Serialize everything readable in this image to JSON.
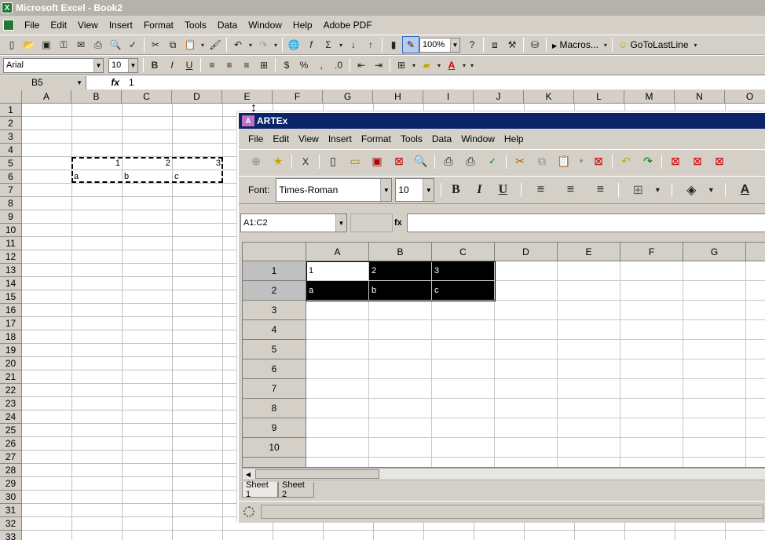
{
  "excel": {
    "title": "Microsoft Excel - Book2",
    "menu": [
      "File",
      "Edit",
      "View",
      "Insert",
      "Format",
      "Tools",
      "Data",
      "Window",
      "Help",
      "Adobe PDF"
    ],
    "toolbar": {
      "zoom": "100%",
      "macros_label": "Macros...",
      "gotolastline_label": "GoToLastLine",
      "font": "Arial",
      "font_size": "10"
    },
    "formula_bar": {
      "name_box": "B5",
      "fx": "fx",
      "value": "1"
    },
    "columns": [
      "A",
      "B",
      "C",
      "D",
      "E",
      "F",
      "G",
      "H",
      "I",
      "J",
      "K",
      "L",
      "M",
      "N",
      "O"
    ],
    "rows": [
      "1",
      "2",
      "3",
      "4",
      "5",
      "6",
      "7",
      "8",
      "9",
      "10",
      "11",
      "12",
      "13",
      "14",
      "15",
      "16",
      "17",
      "18",
      "19",
      "20",
      "21",
      "22",
      "23",
      "24",
      "25",
      "26",
      "27",
      "28",
      "29",
      "30",
      "31",
      "32",
      "33"
    ],
    "cells": {
      "b5": "1",
      "c5": "2",
      "d5": "3",
      "b6": "a",
      "c6": "b",
      "d6": "c"
    }
  },
  "artex": {
    "title": "ARTEx",
    "menu": [
      "File",
      "Edit",
      "View",
      "Insert",
      "Format",
      "Tools",
      "Data",
      "Window",
      "Help"
    ],
    "toolbar": {
      "font_label": "Font:",
      "font": "Times-Roman",
      "font_size": "10",
      "bold": "B",
      "italic": "I",
      "underline": "U",
      "x_button": "X"
    },
    "formula_bar": {
      "name_box": "A1:C2",
      "fx": "fx",
      "value": ""
    },
    "columns": [
      "A",
      "B",
      "C",
      "D",
      "E",
      "F",
      "G"
    ],
    "rows": [
      "1",
      "2",
      "3",
      "4",
      "5",
      "6",
      "7",
      "8",
      "9",
      "10"
    ],
    "cells": {
      "a1": "1",
      "b1": "2",
      "c1": "3",
      "a2": "a",
      "b2": "b",
      "c2": "c"
    },
    "sheet_tabs": [
      "Sheet 1",
      "Sheet 2"
    ]
  }
}
